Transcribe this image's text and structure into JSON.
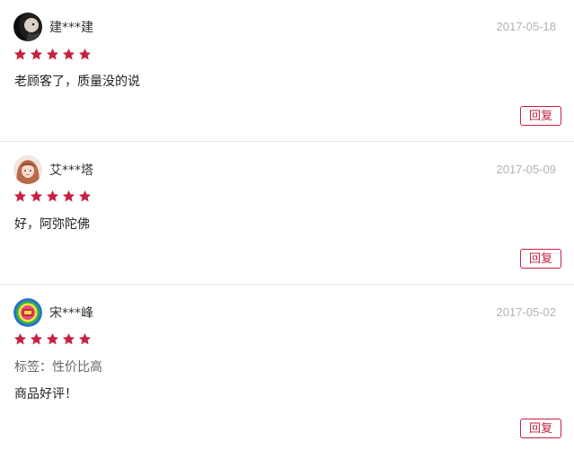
{
  "reviews": [
    {
      "username": "建***建",
      "date": "2017-05-18",
      "rating": 5,
      "tags": "",
      "content": "老顾客了，质量没的说",
      "reply_label": "回复",
      "avatar_icon": "dark-portrait-avatar"
    },
    {
      "username": "艾***塔",
      "date": "2017-05-09",
      "rating": 5,
      "tags": "",
      "content": "好，阿弥陀佛",
      "reply_label": "回复",
      "avatar_icon": "girl-portrait-avatar"
    },
    {
      "username": "宋***峰",
      "date": "2017-05-02",
      "rating": 5,
      "tags": "标签：性价比高",
      "content": "商品好评！",
      "reply_label": "回复",
      "avatar_icon": "colorful-badge-avatar"
    }
  ],
  "colors": {
    "star": "#c8203f",
    "reply_border": "#c8203f",
    "date": "#b3b3b3",
    "divider": "#e6e6e6"
  }
}
